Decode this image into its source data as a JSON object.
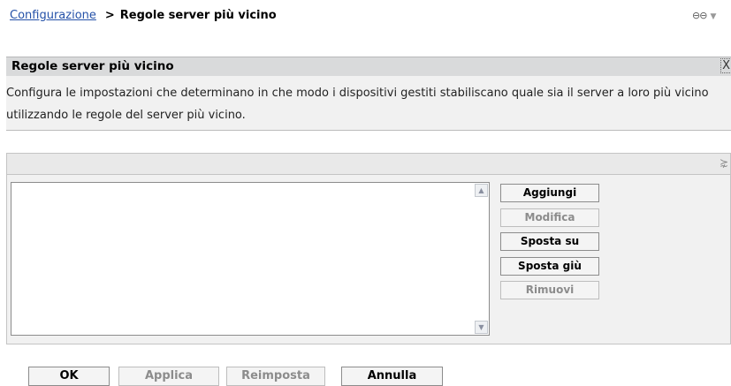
{
  "breadcrumb": {
    "parent": "Configurazione",
    "separator": ">",
    "current": "Regole server più vicino"
  },
  "top_icon": {
    "name": "link-icon",
    "glyph": "⊖⊖",
    "menu_glyph": "▼"
  },
  "panel": {
    "title": "Regole server più vicino",
    "close_glyph": "X",
    "description": "Configura le impostazioni che determinano in che modo i dispositivi gestiti stabiliscano quale sia il server a loro più vicino utilizzando le regole del server più vicino."
  },
  "rules_box": {
    "collapse_glyph": "⋩",
    "scroll_up": "▲",
    "scroll_down": "▼"
  },
  "side_buttons": {
    "add": "Aggiungi",
    "edit": "Modifica",
    "move_up": "Sposta su",
    "move_down": "Sposta giù",
    "remove": "Rimuovi"
  },
  "bottom_buttons": {
    "ok": "OK",
    "apply": "Applica",
    "reset": "Reimposta",
    "cancel": "Annulla"
  }
}
